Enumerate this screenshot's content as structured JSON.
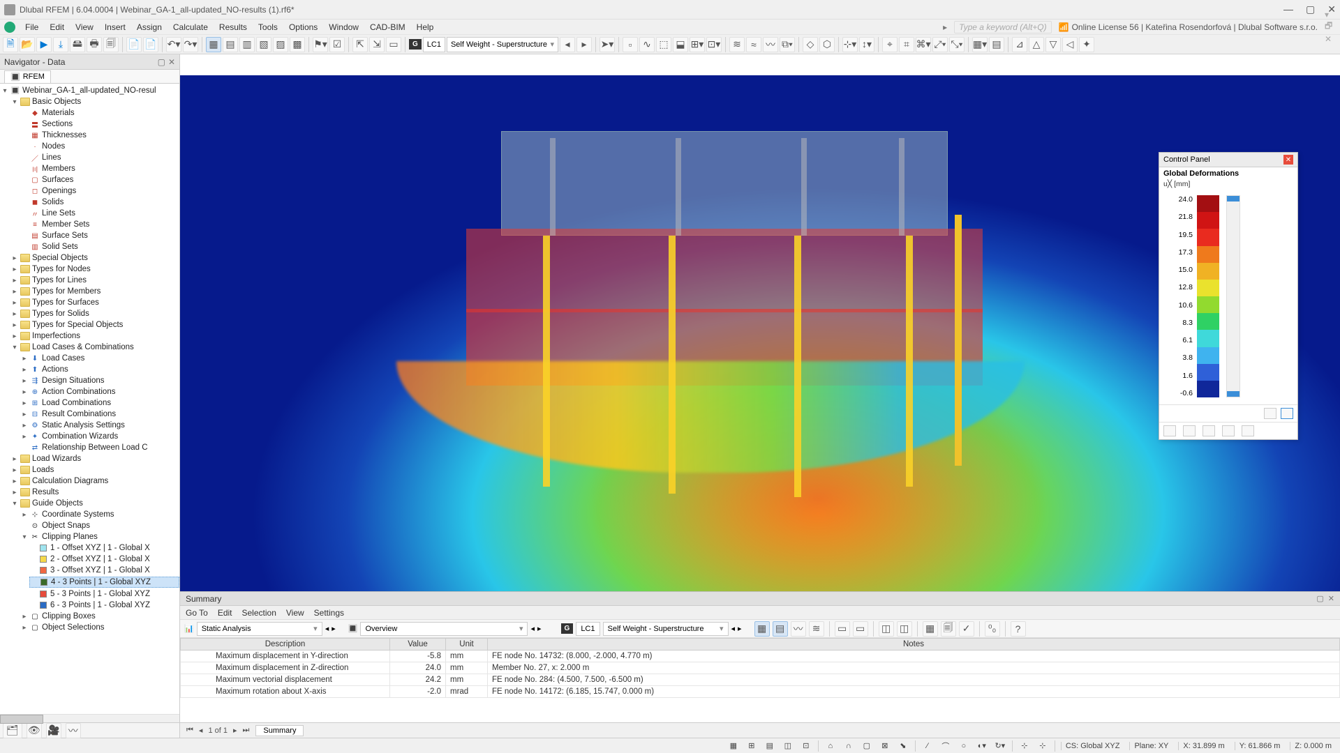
{
  "titlebar": {
    "app": "Dlubal RFEM",
    "version": "6.04.0004",
    "file": "Webinar_GA-1_all-updated_NO-results (1).rf6*"
  },
  "menus": [
    "File",
    "Edit",
    "View",
    "Insert",
    "Assign",
    "Calculate",
    "Results",
    "Tools",
    "Options",
    "Window",
    "CAD-BIM",
    "Help"
  ],
  "search_placeholder": "Type a keyword (Alt+Q)",
  "license": "Online License 56 | Kateřina Rosendorfová | Dlubal Software s.r.o.",
  "lc": {
    "tag": "LC1",
    "name": "Self Weight - Superstructure"
  },
  "navigator": {
    "title": "Navigator - Data",
    "tab": "RFEM",
    "project": "Webinar_GA-1_all-updated_NO-resul",
    "basic": "Basic Objects",
    "basic_items": [
      "Materials",
      "Sections",
      "Thicknesses",
      "Nodes",
      "Lines",
      "Members",
      "Surfaces",
      "Openings",
      "Solids",
      "Line Sets",
      "Member Sets",
      "Surface Sets",
      "Solid Sets"
    ],
    "cat1": [
      "Special Objects",
      "Types for Nodes",
      "Types for Lines",
      "Types for Members",
      "Types for Surfaces",
      "Types for Solids",
      "Types for Special Objects",
      "Imperfections"
    ],
    "lcc": "Load Cases & Combinations",
    "lcc_items": [
      "Load Cases",
      "Actions",
      "Design Situations",
      "Action Combinations",
      "Load Combinations",
      "Result Combinations",
      "Static Analysis Settings",
      "Combination Wizards",
      "Relationship Between Load C"
    ],
    "cat2": [
      "Load Wizards",
      "Loads",
      "Calculation Diagrams",
      "Results"
    ],
    "guide": "Guide Objects",
    "guide_items": [
      "Coordinate Systems",
      "Object Snaps"
    ],
    "clip": "Clipping Planes",
    "clip_items": [
      {
        "c": "#9fe4ef",
        "t": "1 - Offset XYZ | 1 - Global X"
      },
      {
        "c": "#f6d94a",
        "t": "2 - Offset XYZ | 1 - Global X"
      },
      {
        "c": "#f06843",
        "t": "3 - Offset XYZ | 1 - Global X"
      },
      {
        "c": "#3a6b2b",
        "t": "4 - 3 Points | 1 - Global XYZ",
        "sel": true
      },
      {
        "c": "#e74c3c",
        "t": "5 - 3 Points | 1 - Global XYZ"
      },
      {
        "c": "#2b6cc4",
        "t": "6 - 3 Points | 1 - Global XYZ"
      }
    ],
    "tail": [
      "Clipping Boxes",
      "Object Selections"
    ]
  },
  "panel": {
    "title": "Control Panel",
    "sub": "Global Deformations",
    "unit": "u╳ [mm]",
    "vals": [
      "24.0",
      "21.8",
      "19.5",
      "17.3",
      "15.0",
      "12.8",
      "10.6",
      "8.3",
      "6.1",
      "3.8",
      "1.6",
      "-0.6"
    ],
    "colors": [
      "#a30f12",
      "#d01414",
      "#e92b1f",
      "#ef7a1c",
      "#f0b224",
      "#eae22d",
      "#92da2f",
      "#2fd164",
      "#3fd9da",
      "#3fb3ef",
      "#2f60d8",
      "#10279a"
    ]
  },
  "summary": {
    "title": "Summary",
    "menus": [
      "Go To",
      "Edit",
      "Selection",
      "View",
      "Settings"
    ],
    "analysis": "Static Analysis",
    "overview": "Overview",
    "cols": [
      "Description",
      "Value",
      "Unit",
      "Notes"
    ],
    "rows": [
      {
        "d": "Maximum displacement in Y-direction",
        "v": "-5.8",
        "u": "mm",
        "n": "FE node No. 14732: (8.000, -2.000, 4.770 m)"
      },
      {
        "d": "Maximum displacement in Z-direction",
        "v": "24.0",
        "u": "mm",
        "n": "Member No. 27, x: 2.000 m"
      },
      {
        "d": "Maximum vectorial displacement",
        "v": "24.2",
        "u": "mm",
        "n": "FE node No. 284: (4.500, 7.500, -6.500 m)"
      },
      {
        "d": "Maximum rotation about X-axis",
        "v": "-2.0",
        "u": "mrad",
        "n": "FE node No. 14172: (6.185, 15.747, 0.000 m)"
      }
    ],
    "page": "1 of 1",
    "tab": "Summary"
  },
  "status": {
    "cs": "CS: Global XYZ",
    "plane": "Plane: XY",
    "x": "X: 31.899 m",
    "y": "Y: 61.866 m",
    "z": "Z: 0.000 m"
  }
}
